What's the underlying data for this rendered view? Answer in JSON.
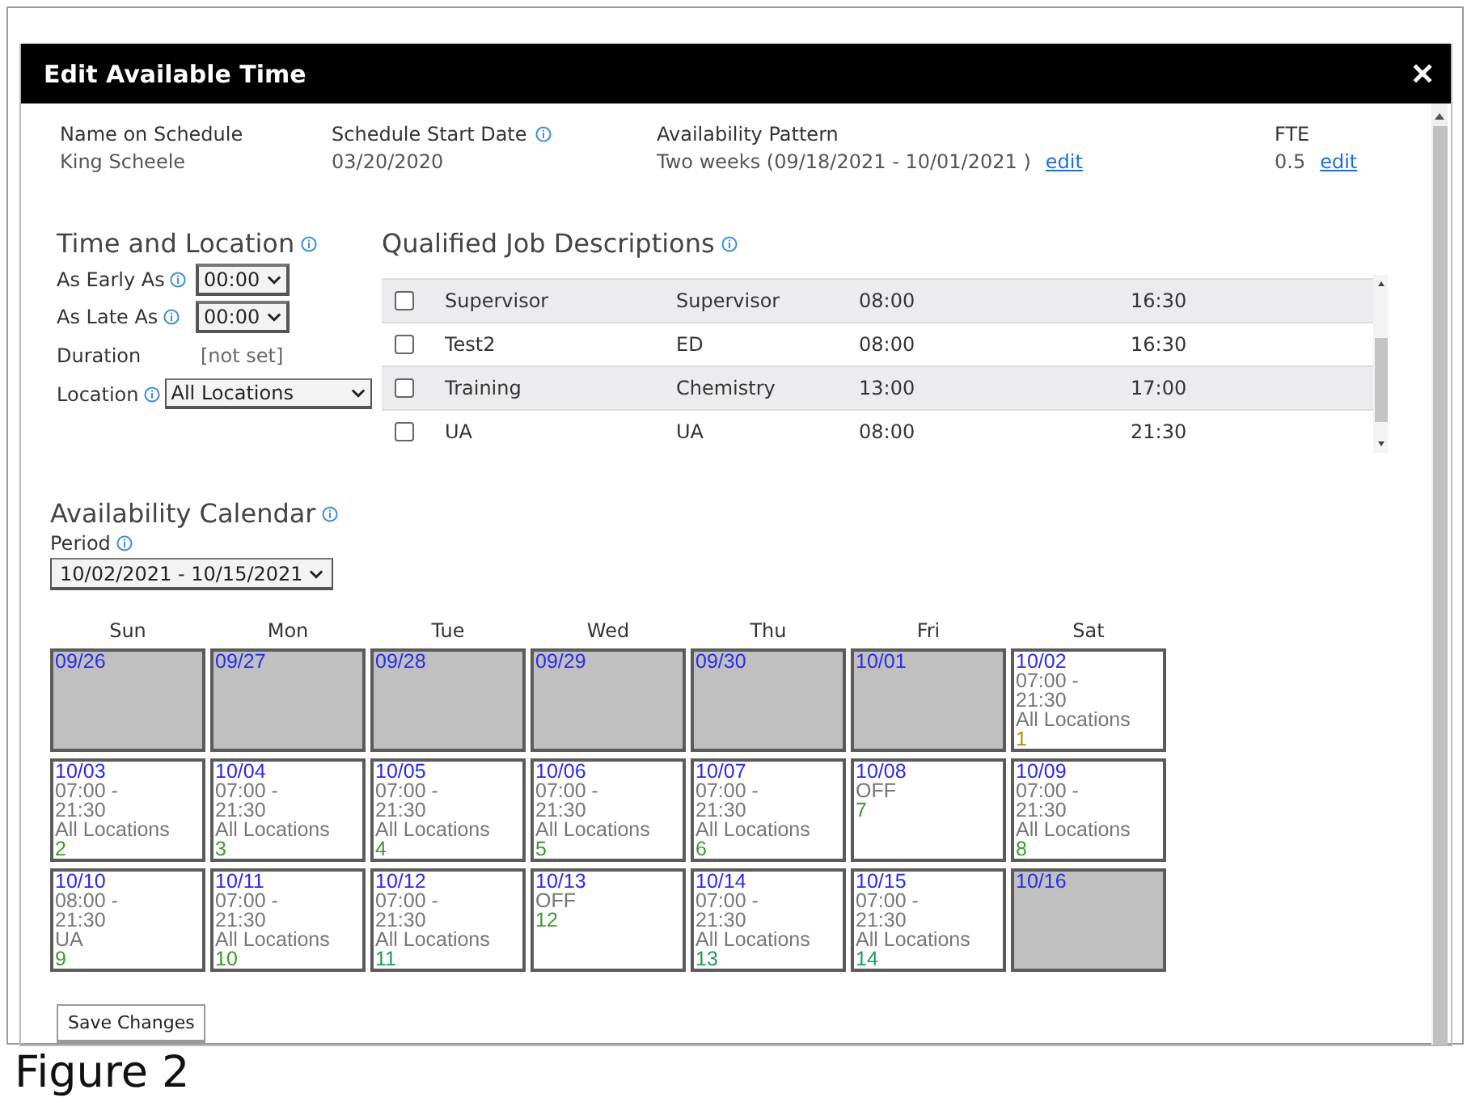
{
  "dialog": {
    "title": "Edit Available Time",
    "close": "✕"
  },
  "summary": [
    {
      "label": "Name on Schedule",
      "value": "King Scheele",
      "info": false
    },
    {
      "label": "Schedule Start Date",
      "value": "03/20/2020",
      "info": true
    },
    {
      "label": "Availability Pattern",
      "value": "Two weeks (09/18/2021 - 10/01/2021 )",
      "info": false,
      "link": "edit"
    },
    {
      "label": "FTE",
      "value": "0.5",
      "info": false,
      "link": "edit"
    }
  ],
  "time_and_location": {
    "title": "Time and Location",
    "fields": [
      {
        "kind": "select",
        "label": "As Early As",
        "value": "00:00"
      },
      {
        "kind": "select",
        "label": "As Late As",
        "value": "00:00"
      },
      {
        "kind": "text",
        "label": "Duration",
        "value": "[not set]"
      },
      {
        "kind": "select",
        "label": "Location",
        "value": "All Locations"
      }
    ]
  },
  "jobs": {
    "title": "Qualified Job Descriptions",
    "rows": [
      {
        "name": "Supervisor",
        "department": "Supervisor",
        "start": "08:00",
        "end": "16:30",
        "checked": false
      },
      {
        "name": "Test2",
        "department": "ED",
        "start": "08:00",
        "end": "16:30",
        "checked": false
      },
      {
        "name": "Training",
        "department": "Chemistry",
        "start": "13:00",
        "end": "17:00",
        "checked": false
      },
      {
        "name": "UA",
        "department": "UA",
        "start": "08:00",
        "end": "21:30",
        "checked": false
      }
    ]
  },
  "calendar": {
    "title": "Availability Calendar",
    "period_label": "Period",
    "period": "10/02/2021 - 10/15/2021",
    "weekdays": [
      "Sun",
      "Mon",
      "Tue",
      "Wed",
      "Thu",
      "Fri",
      "Sat"
    ],
    "days": [
      {
        "kind": "blocked",
        "date": "09/26"
      },
      {
        "kind": "blocked",
        "date": "09/27"
      },
      {
        "kind": "blocked",
        "date": "09/28"
      },
      {
        "kind": "blocked",
        "date": "09/29"
      },
      {
        "kind": "blocked",
        "date": "09/30"
      },
      {
        "kind": "blocked",
        "date": "10/01"
      },
      {
        "kind": "shift",
        "date": "10/02",
        "start": "07:00 -",
        "end": "21:30",
        "location": "All Locations",
        "count": "1",
        "color": "#a09a00"
      },
      {
        "kind": "shift",
        "date": "10/03",
        "start": "07:00 -",
        "end": "21:30",
        "location": "All Locations",
        "count": "2",
        "color": "#3a9a2a"
      },
      {
        "kind": "shift",
        "date": "10/04",
        "start": "07:00 -",
        "end": "21:30",
        "location": "All Locations",
        "count": "3",
        "color": "#3a9a2a"
      },
      {
        "kind": "shift",
        "date": "10/05",
        "start": "07:00 -",
        "end": "21:30",
        "location": "All Locations",
        "count": "4",
        "color": "#3a9a2a"
      },
      {
        "kind": "shift",
        "date": "10/06",
        "start": "07:00 -",
        "end": "21:30",
        "location": "All Locations",
        "count": "5",
        "color": "#3a9a2a"
      },
      {
        "kind": "shift",
        "date": "10/07",
        "start": "07:00 -",
        "end": "21:30",
        "location": "All Locations",
        "count": "6",
        "color": "#3a9a2a"
      },
      {
        "kind": "off",
        "date": "10/08",
        "status": "OFF",
        "count": "7",
        "color": "#3a9a2a"
      },
      {
        "kind": "shift",
        "date": "10/09",
        "start": "07:00 -",
        "end": "21:30",
        "location": "All Locations",
        "count": "8",
        "color": "#3a9a2a"
      },
      {
        "kind": "shift",
        "date": "10/10",
        "start": "08:00 -",
        "end": "21:30",
        "location": "UA",
        "count": "9",
        "color": "#3a9a2a"
      },
      {
        "kind": "shift",
        "date": "10/11",
        "start": "07:00 -",
        "end": "21:30",
        "location": "All Locations",
        "count": "10",
        "color": "#3a9a2a"
      },
      {
        "kind": "shift",
        "date": "10/12",
        "start": "07:00 -",
        "end": "21:30",
        "location": "All Locations",
        "count": "11",
        "color": "#1f9a5a"
      },
      {
        "kind": "off",
        "date": "10/13",
        "status": "OFF",
        "count": "12",
        "color": "#3a9a2a"
      },
      {
        "kind": "shift",
        "date": "10/14",
        "start": "07:00 -",
        "end": "21:30",
        "location": "All Locations",
        "count": "13",
        "color": "#1f9a5a"
      },
      {
        "kind": "shift",
        "date": "10/15",
        "start": "07:00 -",
        "end": "21:30",
        "location": "All Locations",
        "count": "14",
        "color": "#1f9a5a"
      },
      {
        "kind": "blocked",
        "date": "10/16"
      }
    ]
  },
  "save_button": "Save Changes",
  "caption": "Figure 2"
}
